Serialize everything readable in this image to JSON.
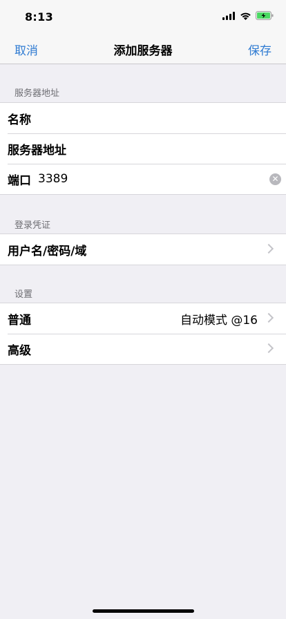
{
  "status_bar": {
    "time": "8:13"
  },
  "navbar": {
    "cancel": "取消",
    "title": "添加服务器",
    "save": "保存"
  },
  "sections": {
    "server": {
      "header": "服务器地址",
      "name_label": "名称",
      "address_label": "服务器地址",
      "port_label": "端口",
      "port_value": "3389"
    },
    "credentials": {
      "header": "登录凭证",
      "user_label": "用户名/密码/域"
    },
    "settings": {
      "header": "设置",
      "general_label": "普通",
      "general_value": "自动模式 @16",
      "advanced_label": "高级"
    }
  },
  "colors": {
    "accent": "#2f7bd2",
    "background": "#f0eff4",
    "secondary_text": "#6d6d72"
  },
  "icons": [
    "signal-icon",
    "wifi-icon",
    "battery-icon",
    "clear-icon",
    "chevron-right-icon"
  ]
}
